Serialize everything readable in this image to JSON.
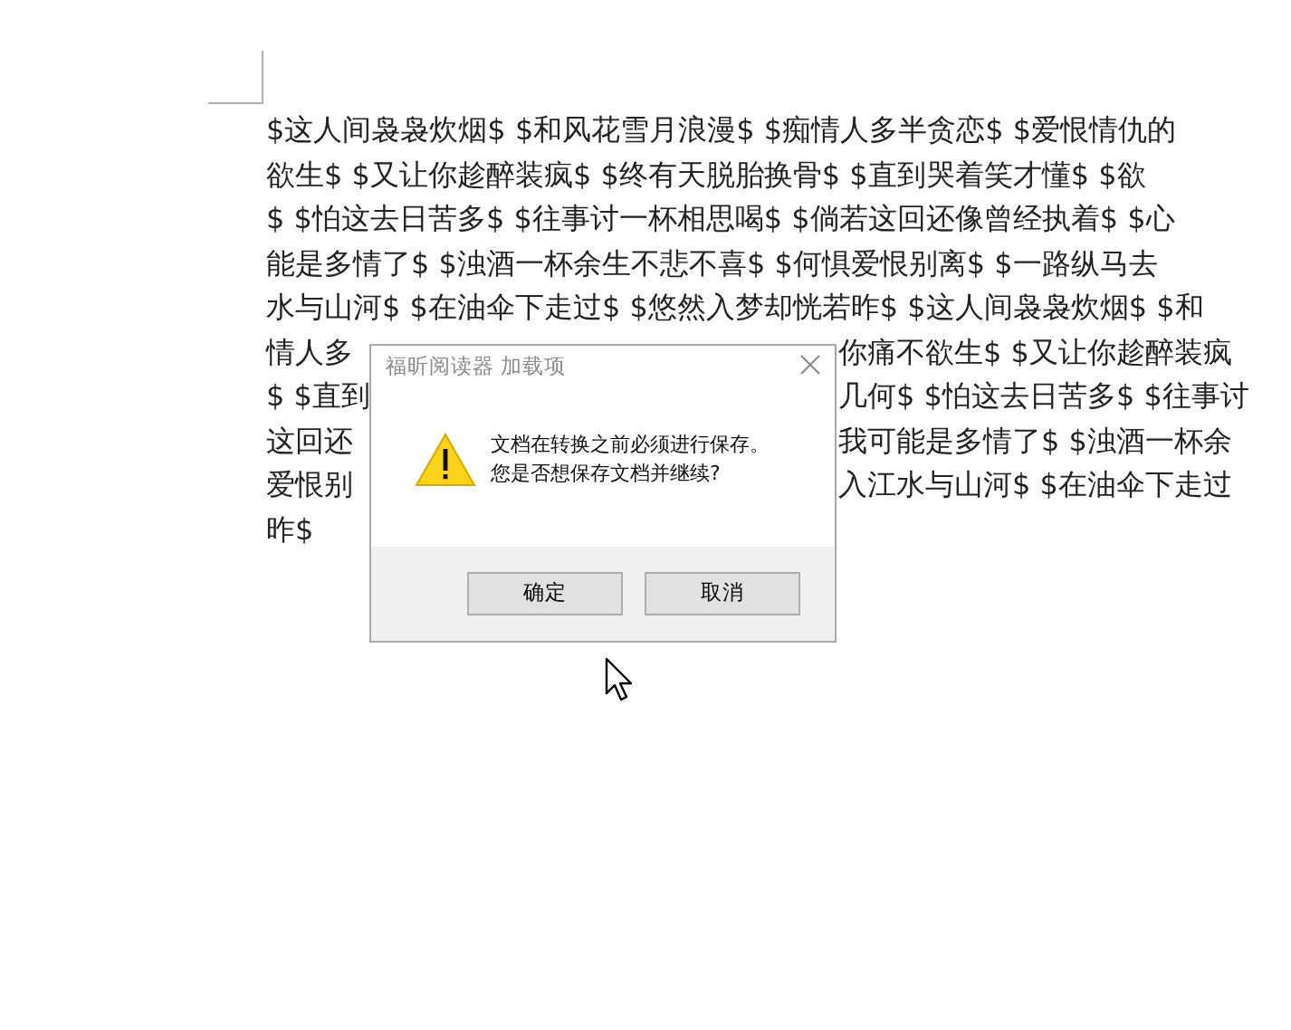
{
  "document": {
    "lines": [
      {
        "parts": [
          "$这人间袅袅炊烟$ $和风花雪月浪漫$ $痴情人多半贪恋$ $爱恨情仇的"
        ]
      },
      {
        "parts": [
          "欲生$ $又让你趁醉装疯$ $终有天脱胎换骨$ $直到哭着笑才懂$ $欲"
        ]
      },
      {
        "parts": [
          "$ $怕这去日苦多$ $往事讨一杯相思喝$ $倘若这回还像曾经执着$ $心"
        ]
      },
      {
        "parts": [
          "能是多情了$ $浊酒一杯余生不悲不喜$ $何惧爱恨别离$ $一路纵马去"
        ]
      },
      {
        "parts": [
          "水与山河$ $在油伞下走过$ $悠然入梦却恍若昨$ $这人间袅袅炊烟$ $和"
        ]
      },
      {
        "parts": [
          "情人多",
          "你痛不欲生$ $又让你趁醉装疯"
        ]
      },
      {
        "parts": [
          "$ $直到",
          "几何$ $怕这去日苦多$ $往事讨"
        ]
      },
      {
        "parts": [
          "这回还",
          "我可能是多情了$ $浊酒一杯余"
        ]
      },
      {
        "parts": [
          "爱恨别",
          "入江水与山河$ $在油伞下走过"
        ]
      },
      {
        "parts": [
          "昨$"
        ]
      }
    ]
  },
  "dialog": {
    "title": "福昕阅读器 加载项",
    "message": [
      "文档在转换之前必须进行保存。",
      "您是否想保存文档并继续?"
    ],
    "buttons": [
      "确定",
      "取消"
    ]
  }
}
